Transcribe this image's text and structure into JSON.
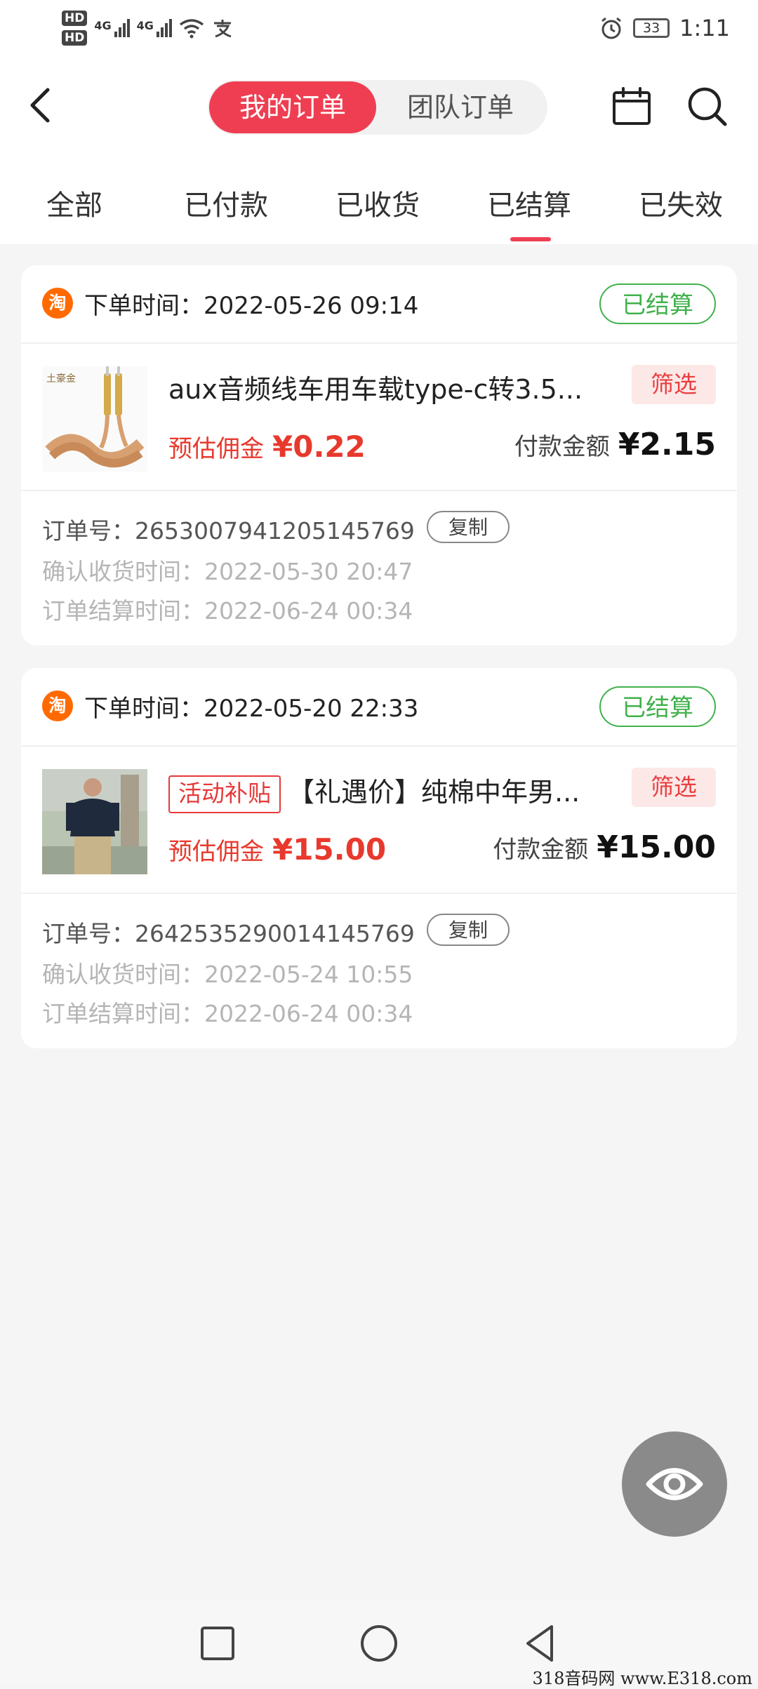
{
  "status_bar": {
    "hd1": "HD",
    "hd2": "HD",
    "net1": "4G",
    "net2": "4G",
    "battery": "33",
    "time": "1:11"
  },
  "header": {
    "tab_active": "我的订单",
    "tab_inactive": "团队订单"
  },
  "tabs": [
    "全部",
    "已付款",
    "已收货",
    "已结算",
    "已失效"
  ],
  "active_tab_index": 3,
  "orders": [
    {
      "shop_icon": "淘",
      "order_time_label": "下单时间：",
      "order_time": "2022-05-26 09:14",
      "status": "已结算",
      "product_name": "aux音频线车用车载type-c转3.5...",
      "activity_tag": "",
      "filter": "筛选",
      "commission_label": "预估佣金",
      "commission": "¥0.22",
      "pay_label": "付款金额",
      "pay_amount": "¥2.15",
      "order_no_label": "订单号：",
      "order_no": "2653007941205145769",
      "copy": "复制",
      "confirm_label": "确认收货时间：",
      "confirm_time": "2022-05-30 20:47",
      "settle_label": "订单结算时间：",
      "settle_time": "2022-06-24 00:34",
      "thumb_text": "土豪金"
    },
    {
      "shop_icon": "淘",
      "order_time_label": "下单时间：",
      "order_time": "2022-05-20 22:33",
      "status": "已结算",
      "product_name": "【礼遇价】纯棉中年男...",
      "activity_tag": "活动补贴",
      "filter": "筛选",
      "commission_label": "预估佣金",
      "commission": "¥15.00",
      "pay_label": "付款金额",
      "pay_amount": "¥15.00",
      "order_no_label": "订单号：",
      "order_no": "2642535290014145769",
      "copy": "复制",
      "confirm_label": "确认收货时间：",
      "confirm_time": "2022-05-24 10:55",
      "settle_label": "订单结算时间：",
      "settle_time": "2022-06-24 00:34"
    }
  ],
  "fab_icon": "eye-icon",
  "nav": [
    "square-icon",
    "circle-icon",
    "triangle-back-icon"
  ],
  "watermark": "318音码网 www.E318.com",
  "colors": {
    "accent": "#ef3e52",
    "status_green": "#41b14b",
    "commission_red": "#e8392d",
    "taobao_orange": "#ff6a00"
  }
}
